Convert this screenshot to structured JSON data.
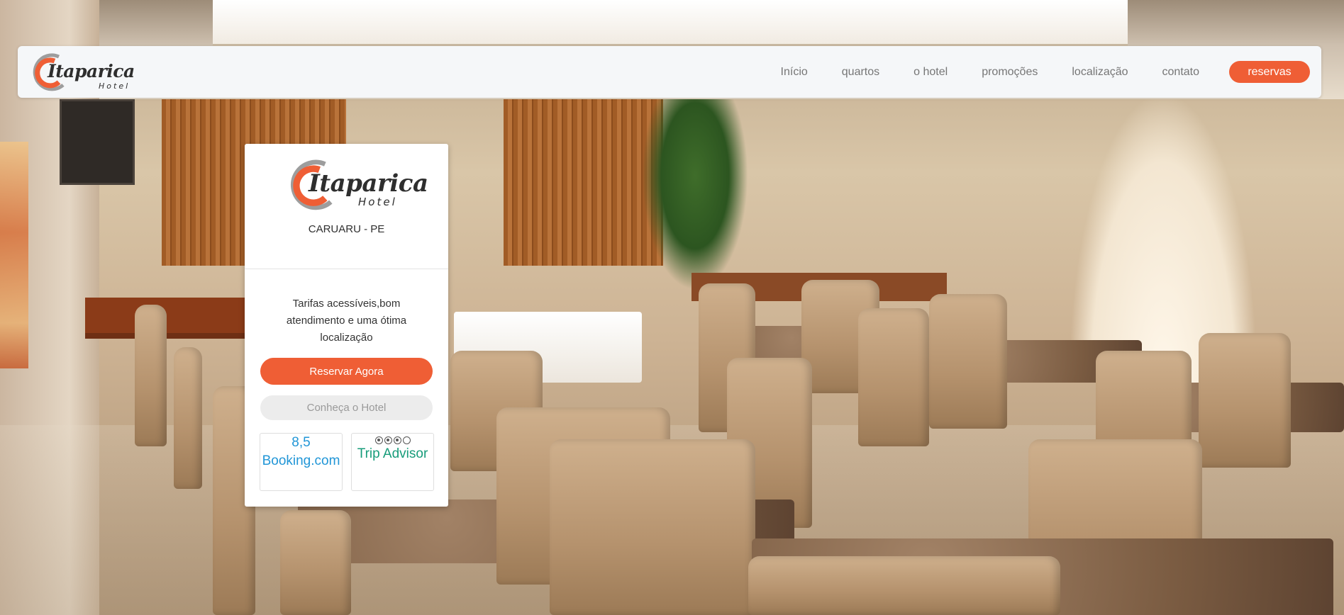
{
  "brand": {
    "logo_text": "Itaparica",
    "logo_subtext": "Hotel",
    "colors": {
      "accent": "#ef5e35",
      "logo_gray": "#9d9d9d",
      "text_dark": "#2e2e2e"
    }
  },
  "nav": {
    "items": [
      {
        "label": "Início"
      },
      {
        "label": "quartos"
      },
      {
        "label": "o hotel"
      },
      {
        "label": "promoções"
      },
      {
        "label": "localização"
      },
      {
        "label": "contato"
      }
    ],
    "cta_label": "reservas"
  },
  "card": {
    "location": "CARUARU - PE",
    "tagline": "Tarifas acessíveis,bom atendimento e uma ótima localização",
    "primary_button": "Reservar Agora",
    "secondary_button": "Conheça o Hotel",
    "ratings": {
      "booking": {
        "score": "8,5",
        "name": "Booking.com",
        "color": "#2196d7"
      },
      "tripadvisor": {
        "bubbles_filled": 3,
        "bubbles_total": 4,
        "name": "Trip Advisor",
        "color": "#179c7a"
      }
    }
  },
  "background": {
    "scene": "restaurant-dining-room-photo"
  }
}
